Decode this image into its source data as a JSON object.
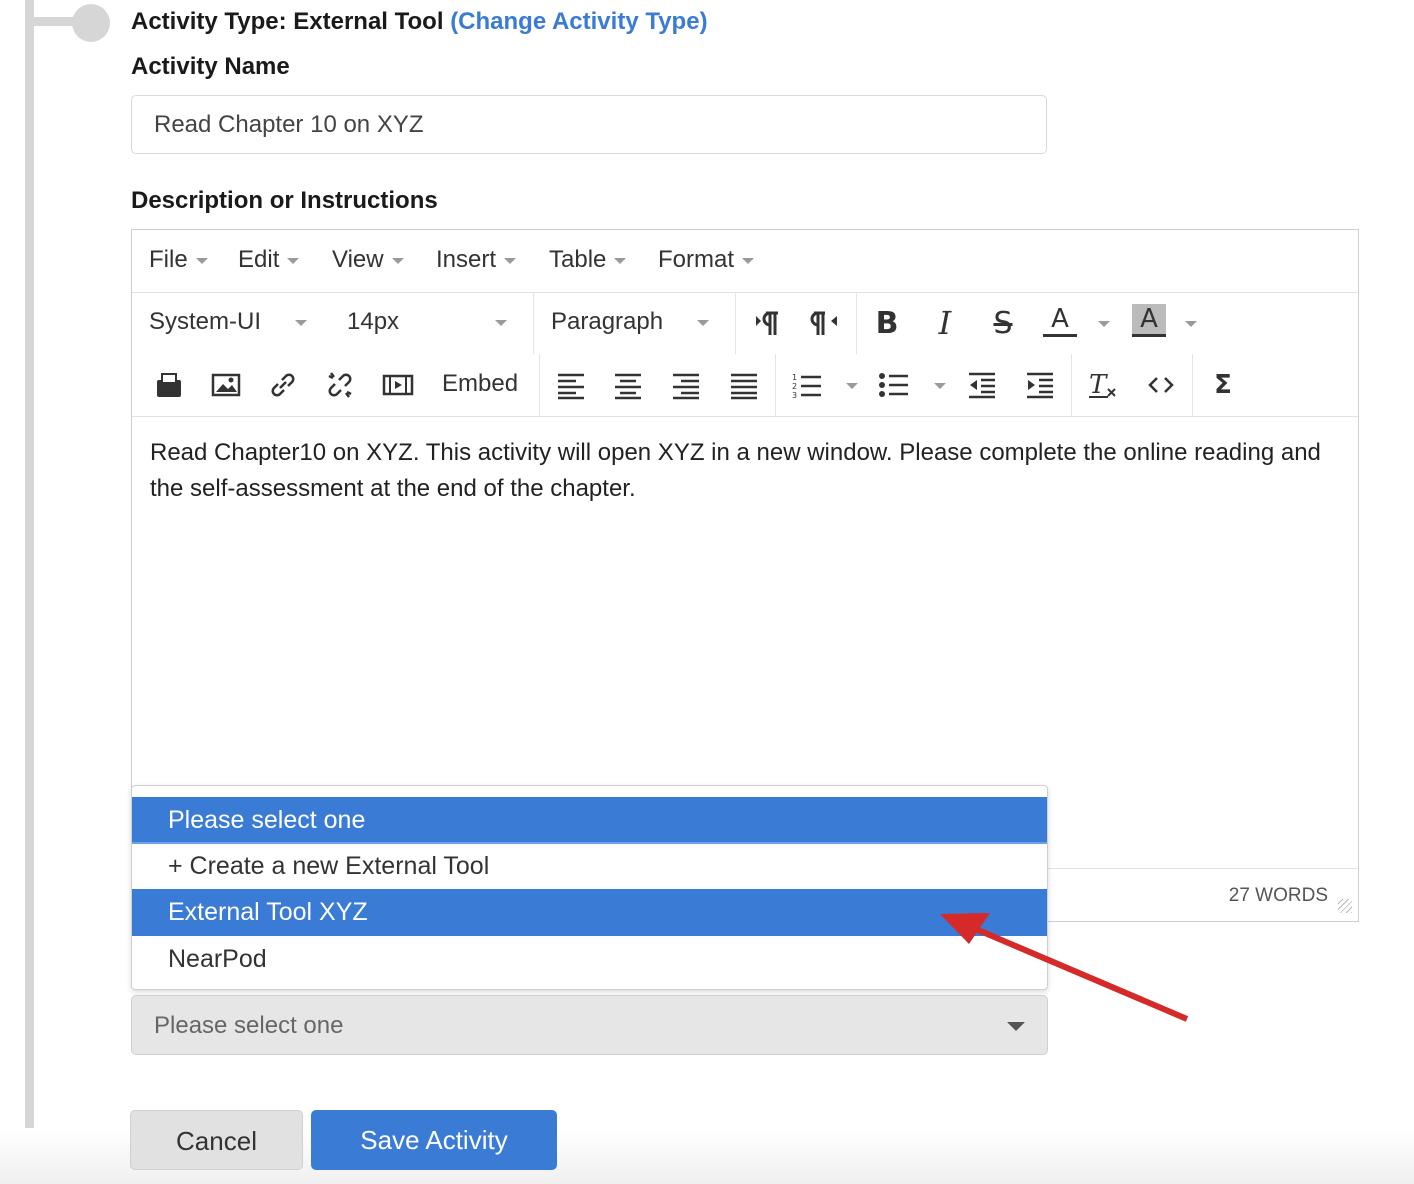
{
  "activity_type": {
    "label": "Activity Type: External Tool",
    "change_link": "(Change Activity Type)"
  },
  "activity_name": {
    "label": "Activity Name",
    "value": "Read Chapter 10 on XYZ"
  },
  "description": {
    "label": "Description or Instructions",
    "menus": [
      "File",
      "Edit",
      "View",
      "Insert",
      "Table",
      "Format"
    ],
    "font_family": "System-UI",
    "font_size": "14px",
    "block_format": "Paragraph",
    "embed_label": "Embed",
    "body_text": "Read Chapter10 on XYZ. This activity will open XYZ in a new window. Please complete the online reading and the self-assessment at the end of the chapter.",
    "word_count": "27 WORDS"
  },
  "tool_dropdown": {
    "options": [
      "Please select one",
      "+ Create a new External Tool",
      "External Tool XYZ",
      "NearPod"
    ],
    "highlighted": [
      "Please select one",
      "External Tool XYZ"
    ],
    "selected_value": "Please select one"
  },
  "buttons": {
    "cancel": "Cancel",
    "save": "Save Activity"
  },
  "colors": {
    "accent": "#3a7bd5",
    "annotation_arrow": "#d42a2a"
  },
  "icons": [
    "paragraph-ltr-icon",
    "paragraph-rtl-icon",
    "bold-icon",
    "italic-icon",
    "strikethrough-icon",
    "text-color-icon",
    "background-color-icon",
    "file-icon",
    "image-icon",
    "link-icon",
    "unlink-icon",
    "media-icon",
    "align-left-icon",
    "align-center-icon",
    "align-right-icon",
    "justify-icon",
    "numbered-list-icon",
    "bullet-list-icon",
    "outdent-icon",
    "indent-icon",
    "clear-format-icon",
    "code-icon",
    "sigma-icon"
  ]
}
